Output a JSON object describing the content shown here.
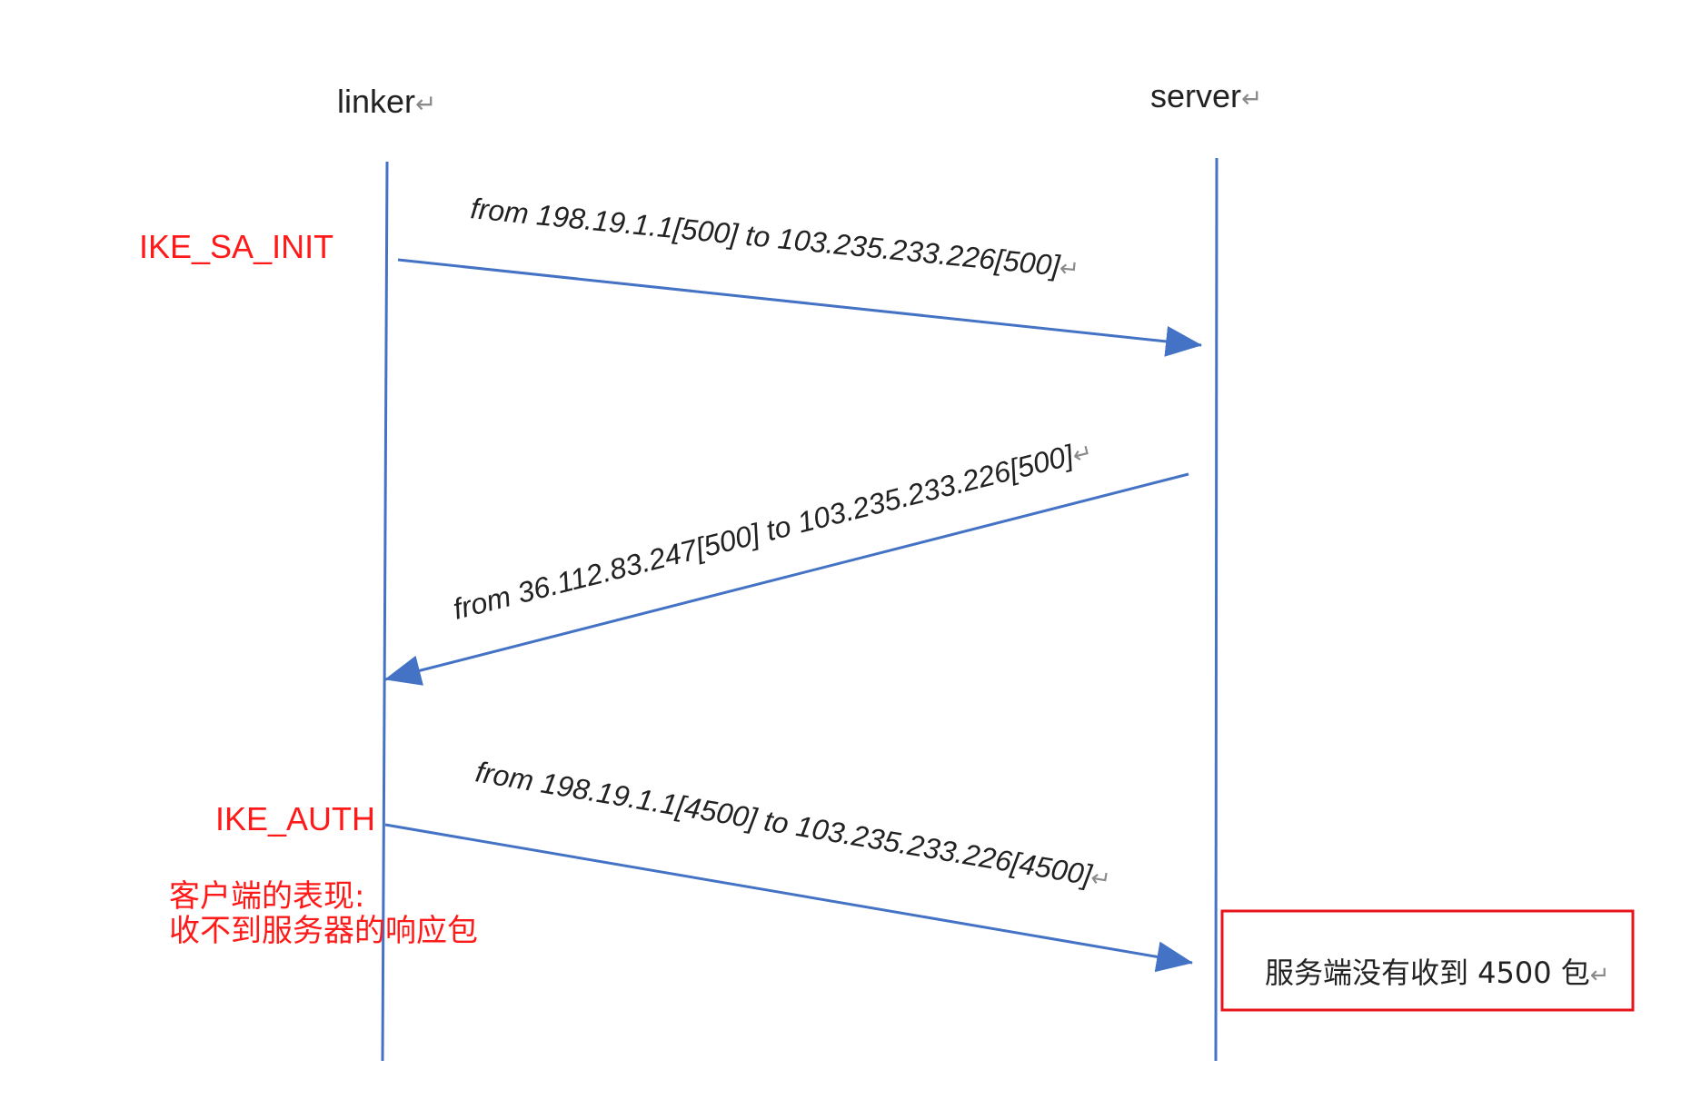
{
  "colors": {
    "lifeline": "#4472C4",
    "arrow": "#4472C4",
    "annotation": "#FF1A1A",
    "box_border": "#E8141C",
    "text": "#222222"
  },
  "return_glyph": "↵",
  "actors": {
    "client": {
      "label": "linker"
    },
    "server": {
      "label": "server"
    }
  },
  "messages": [
    {
      "from": "client",
      "to": "server",
      "label": "from 198.19.1.1[500] to 103.235.233.226[500]"
    },
    {
      "from": "server",
      "to": "client",
      "label": "from 36.112.83.247[500] to 103.235.233.226[500]"
    },
    {
      "from": "client",
      "to": "server",
      "label": "from 198.19.1.1[4500] to 103.235.233.226[4500]"
    }
  ],
  "phases": {
    "ike_sa_init": "IKE_SA_INIT",
    "ike_auth": "IKE_AUTH"
  },
  "client_note": {
    "line1": "客户端的表现:",
    "line2": "收不到服务器的响应包"
  },
  "server_note": {
    "label": "服务端没有收到 4500 包"
  }
}
